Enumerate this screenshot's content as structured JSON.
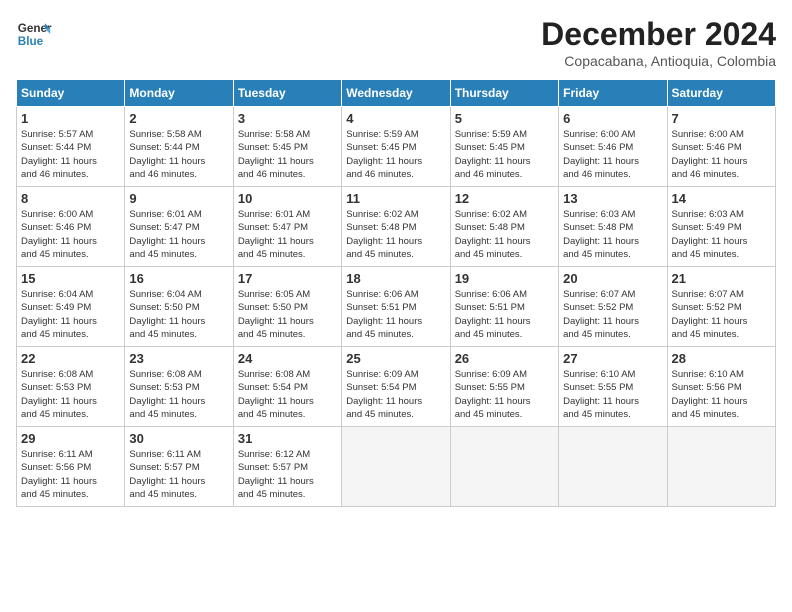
{
  "logo": {
    "line1": "General",
    "line2": "Blue"
  },
  "title": "December 2024",
  "location": "Copacabana, Antioquia, Colombia",
  "headers": [
    "Sunday",
    "Monday",
    "Tuesday",
    "Wednesday",
    "Thursday",
    "Friday",
    "Saturday"
  ],
  "weeks": [
    [
      {
        "day": "1",
        "info": "Sunrise: 5:57 AM\nSunset: 5:44 PM\nDaylight: 11 hours\nand 46 minutes."
      },
      {
        "day": "2",
        "info": "Sunrise: 5:58 AM\nSunset: 5:44 PM\nDaylight: 11 hours\nand 46 minutes."
      },
      {
        "day": "3",
        "info": "Sunrise: 5:58 AM\nSunset: 5:45 PM\nDaylight: 11 hours\nand 46 minutes."
      },
      {
        "day": "4",
        "info": "Sunrise: 5:59 AM\nSunset: 5:45 PM\nDaylight: 11 hours\nand 46 minutes."
      },
      {
        "day": "5",
        "info": "Sunrise: 5:59 AM\nSunset: 5:45 PM\nDaylight: 11 hours\nand 46 minutes."
      },
      {
        "day": "6",
        "info": "Sunrise: 6:00 AM\nSunset: 5:46 PM\nDaylight: 11 hours\nand 46 minutes."
      },
      {
        "day": "7",
        "info": "Sunrise: 6:00 AM\nSunset: 5:46 PM\nDaylight: 11 hours\nand 46 minutes."
      }
    ],
    [
      {
        "day": "8",
        "info": "Sunrise: 6:00 AM\nSunset: 5:46 PM\nDaylight: 11 hours\nand 45 minutes."
      },
      {
        "day": "9",
        "info": "Sunrise: 6:01 AM\nSunset: 5:47 PM\nDaylight: 11 hours\nand 45 minutes."
      },
      {
        "day": "10",
        "info": "Sunrise: 6:01 AM\nSunset: 5:47 PM\nDaylight: 11 hours\nand 45 minutes."
      },
      {
        "day": "11",
        "info": "Sunrise: 6:02 AM\nSunset: 5:48 PM\nDaylight: 11 hours\nand 45 minutes."
      },
      {
        "day": "12",
        "info": "Sunrise: 6:02 AM\nSunset: 5:48 PM\nDaylight: 11 hours\nand 45 minutes."
      },
      {
        "day": "13",
        "info": "Sunrise: 6:03 AM\nSunset: 5:48 PM\nDaylight: 11 hours\nand 45 minutes."
      },
      {
        "day": "14",
        "info": "Sunrise: 6:03 AM\nSunset: 5:49 PM\nDaylight: 11 hours\nand 45 minutes."
      }
    ],
    [
      {
        "day": "15",
        "info": "Sunrise: 6:04 AM\nSunset: 5:49 PM\nDaylight: 11 hours\nand 45 minutes."
      },
      {
        "day": "16",
        "info": "Sunrise: 6:04 AM\nSunset: 5:50 PM\nDaylight: 11 hours\nand 45 minutes."
      },
      {
        "day": "17",
        "info": "Sunrise: 6:05 AM\nSunset: 5:50 PM\nDaylight: 11 hours\nand 45 minutes."
      },
      {
        "day": "18",
        "info": "Sunrise: 6:06 AM\nSunset: 5:51 PM\nDaylight: 11 hours\nand 45 minutes."
      },
      {
        "day": "19",
        "info": "Sunrise: 6:06 AM\nSunset: 5:51 PM\nDaylight: 11 hours\nand 45 minutes."
      },
      {
        "day": "20",
        "info": "Sunrise: 6:07 AM\nSunset: 5:52 PM\nDaylight: 11 hours\nand 45 minutes."
      },
      {
        "day": "21",
        "info": "Sunrise: 6:07 AM\nSunset: 5:52 PM\nDaylight: 11 hours\nand 45 minutes."
      }
    ],
    [
      {
        "day": "22",
        "info": "Sunrise: 6:08 AM\nSunset: 5:53 PM\nDaylight: 11 hours\nand 45 minutes."
      },
      {
        "day": "23",
        "info": "Sunrise: 6:08 AM\nSunset: 5:53 PM\nDaylight: 11 hours\nand 45 minutes."
      },
      {
        "day": "24",
        "info": "Sunrise: 6:08 AM\nSunset: 5:54 PM\nDaylight: 11 hours\nand 45 minutes."
      },
      {
        "day": "25",
        "info": "Sunrise: 6:09 AM\nSunset: 5:54 PM\nDaylight: 11 hours\nand 45 minutes."
      },
      {
        "day": "26",
        "info": "Sunrise: 6:09 AM\nSunset: 5:55 PM\nDaylight: 11 hours\nand 45 minutes."
      },
      {
        "day": "27",
        "info": "Sunrise: 6:10 AM\nSunset: 5:55 PM\nDaylight: 11 hours\nand 45 minutes."
      },
      {
        "day": "28",
        "info": "Sunrise: 6:10 AM\nSunset: 5:56 PM\nDaylight: 11 hours\nand 45 minutes."
      }
    ],
    [
      {
        "day": "29",
        "info": "Sunrise: 6:11 AM\nSunset: 5:56 PM\nDaylight: 11 hours\nand 45 minutes."
      },
      {
        "day": "30",
        "info": "Sunrise: 6:11 AM\nSunset: 5:57 PM\nDaylight: 11 hours\nand 45 minutes."
      },
      {
        "day": "31",
        "info": "Sunrise: 6:12 AM\nSunset: 5:57 PM\nDaylight: 11 hours\nand 45 minutes."
      },
      {
        "day": "",
        "info": ""
      },
      {
        "day": "",
        "info": ""
      },
      {
        "day": "",
        "info": ""
      },
      {
        "day": "",
        "info": ""
      }
    ]
  ]
}
